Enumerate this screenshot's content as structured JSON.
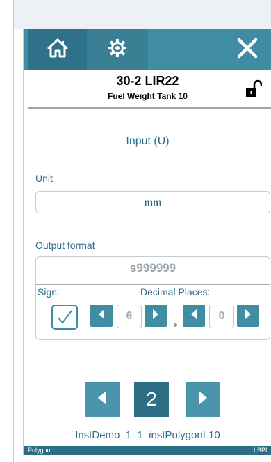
{
  "toolbar": {
    "home_icon": "home-icon",
    "settings_icon": "gear-icon",
    "close_icon": "close-icon"
  },
  "header": {
    "title": "30-2 LIR22",
    "subtitle": "Fuel Weight Tank 10",
    "lock_icon": "unlocked-padlock-icon"
  },
  "input_label": "Input (U)",
  "unit": {
    "label": "Unit",
    "value": "mm"
  },
  "output_format": {
    "label": "Output format",
    "value": "s999999",
    "sign_label": "Sign:",
    "sign_checked": true,
    "decimal_places_label": "Decimal Places:",
    "integer_digits": "6",
    "decimal_digits": "0"
  },
  "pager": {
    "current_page": "2"
  },
  "instance_name": "InstDemo_1_1_instPolygonL10",
  "status": {
    "left": "Polygon",
    "right": "LBPL"
  },
  "colors": {
    "accent": "#3f8ca3",
    "accent_dark": "#2c6f87",
    "text_blue": "#2d6d8a"
  }
}
